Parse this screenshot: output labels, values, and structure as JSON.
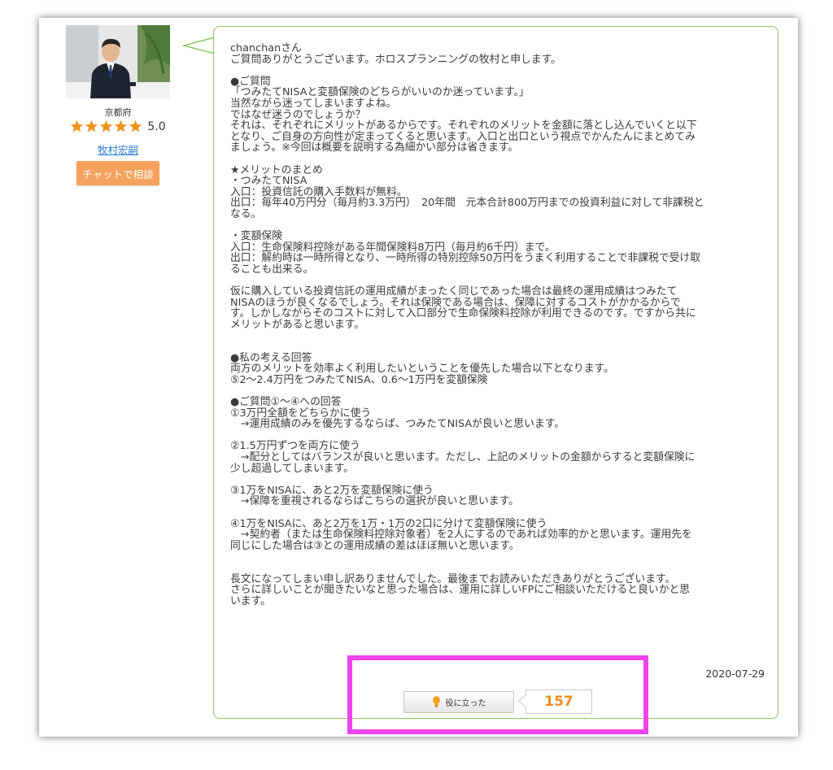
{
  "profile": {
    "prefecture": "京都府",
    "rating": 5.0,
    "rating_text": "5.0",
    "name": "牧村宏嗣",
    "chat_button": "チャットで相談"
  },
  "answer": {
    "body": "chanchanさん\nご質問ありがとうございます。ホロスプランニングの牧村と申します。\n\n●ご質問\n「つみたてNISAと変額保険のどちらがいいのか迷っています。」\n当然ながら迷ってしまいますよね。\nではなぜ迷うのでしょうか？\nそれは、それぞれにメリットがあるからです。それぞれのメリットを金額に落とし込んでいくと以下\nとなり、ご自身の方向性が定まってくると思います。入口と出口という視点でかんたんにまとめてみ\nましょう。※今回は概要を説明する為細かい部分は省きます。\n\n★メリットのまとめ\n・つみたてNISA\n入口：投資信託の購入手数料が無料。\n出口：毎年40万円分（毎月約3.3万円）　20年間　元本合計800万円までの投資利益に対して非課税と\nなる。\n\n・変額保険\n入口：生命保険料控除がある年間保険料8万円（毎月約6千円）まで。\n出口：解約時は一時所得となり、一時所得の特別控除50万円をうまく利用することで非課税で受け取\nることも出来る。\n\n仮に購入している投資信託の運用成績がまったく同じであった場合は最終の運用成績はつみたて\nNISAのほうが良くなるでしょう。それは保険である場合は、保障に対するコストがかかるからで\nす。しかしながらそのコストに対して入口部分で生命保険料控除が利用できるのです。ですから共に\nメリットがあると思います。\n\n\n●私の考える回答\n両方のメリットを効率よく利用したいということを優先した場合以下となります。\n⑤2〜2.4万円をつみたてNISA、0.6〜1万円を変額保険\n\n●ご質問①〜④への回答\n①3万円全額をどちらかに使う\n　→運用成績のみを優先するならば、つみたてNISAが良いと思います。\n\n②1.5万円ずつを両方に使う\n　→配分としてはバランスが良いと思います。ただし、上記のメリットの金額からすると変額保険に\n少し超過してしまいます。\n\n③1万をNISAに、あと2万を変額保険に使う\n　→保障を重視されるならばこちらの選択が良いと思います。\n\n④1万をNISAに、あと2万を1万・1万の2口に分けて変額保険に使う\n　→契約者（または生命保険料控除対象者）を2人にするのであれば効率的かと思います。運用先を\n同じにした場合は③との運用成績の差はほぼ無いと思います。\n\n\n長文になってしまい申し訳ありませんでした。最後までお読みいただきありがとうございます。\nさらに詳しいことが聞きたいなと思った場合は、運用に詳しいFPにご相談いただけると良いかと思\nいます。",
    "date": "2020-07-29",
    "helpful_label": "役に立った",
    "helpful_count": "157"
  },
  "icons": {
    "star": "star-icon",
    "bulb": "lightbulb-icon"
  },
  "colors": {
    "star": "#f0921e",
    "bubble_border": "#8cc85c",
    "chat_button": "#f5a15d",
    "link": "#2a7fd0",
    "count": "#f08c1e",
    "highlight": "#ee44ee"
  }
}
